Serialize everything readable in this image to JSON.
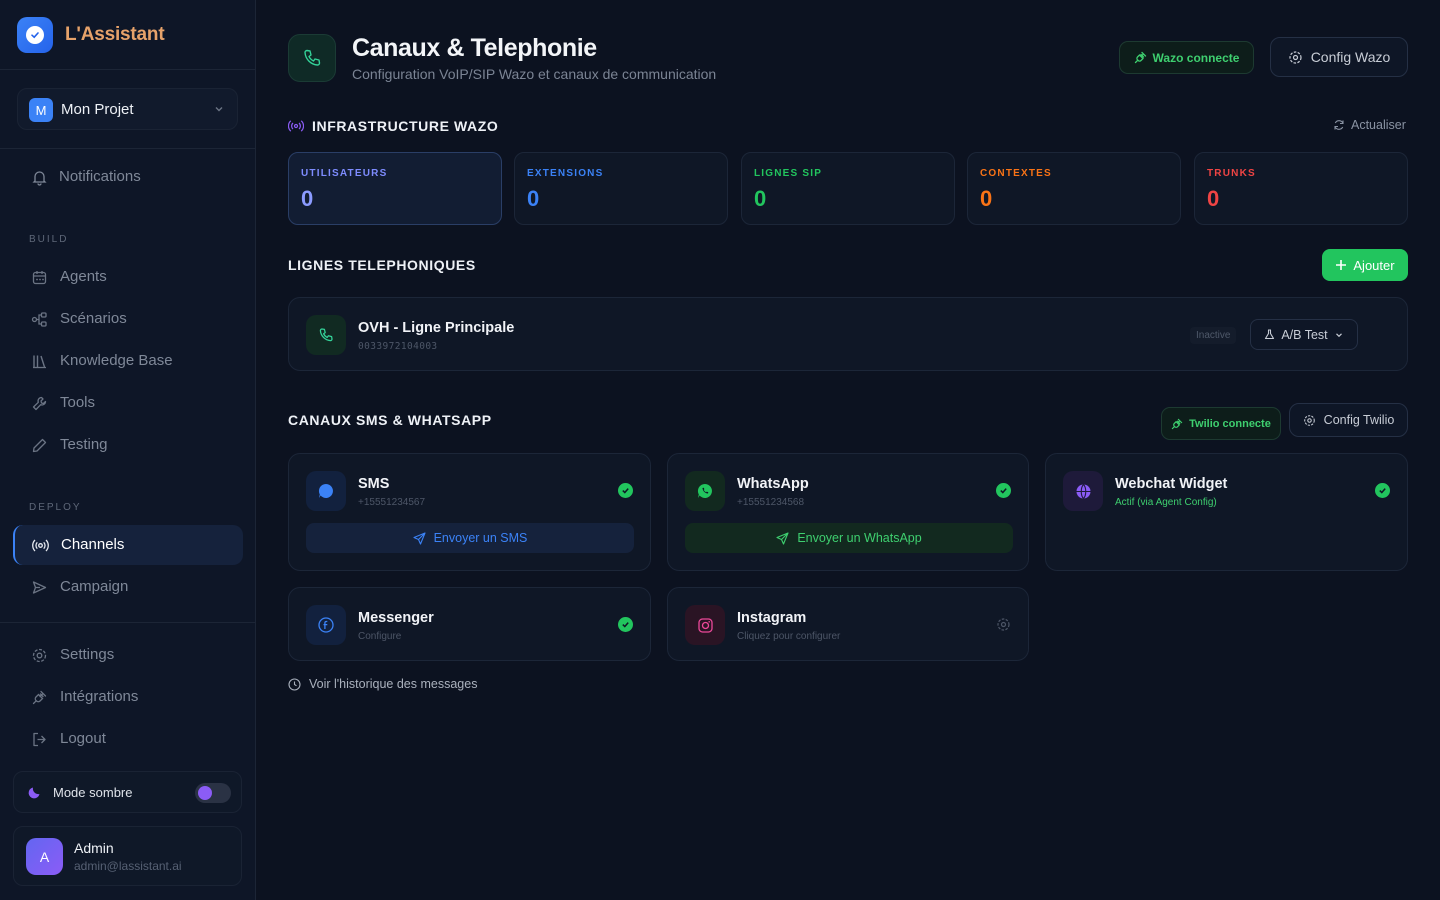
{
  "brand": {
    "name": "L'Assistant"
  },
  "project": {
    "initial": "M",
    "name": "Mon Projet"
  },
  "sidebar": {
    "notifications": "Notifications",
    "build_title": "BUILD",
    "build_items": [
      "Agents",
      "Scénarios",
      "Knowledge Base",
      "Tools",
      "Testing"
    ],
    "deploy_title": "DEPLOY",
    "deploy_items": [
      "Channels",
      "Campaign"
    ],
    "bottom_items": [
      "Settings",
      "Intégrations",
      "Logout"
    ],
    "theme_label": "Mode sombre",
    "user": {
      "initial": "A",
      "name": "Admin",
      "email": "admin@lassistant.ai"
    }
  },
  "header": {
    "title": "Canaux & Telephonie",
    "subtitle": "Configuration VoIP/SIP Wazo et canaux de communication",
    "wazo_status": "Wazo connecte",
    "config_wazo": "Config Wazo"
  },
  "infra": {
    "title": "INFRASTRUCTURE WAZO",
    "refresh": "Actualiser",
    "stats": [
      {
        "label": "UTILISATEURS",
        "value": "0",
        "color": "#8b9bff"
      },
      {
        "label": "EXTENSIONS",
        "value": "0",
        "color": "#3b82f6"
      },
      {
        "label": "LIGNES SIP",
        "value": "0",
        "color": "#22c55e"
      },
      {
        "label": "CONTEXTES",
        "value": "0",
        "color": "#f97316"
      },
      {
        "label": "TRUNKS",
        "value": "0",
        "color": "#ef4444"
      }
    ]
  },
  "lines": {
    "title": "LIGNES TELEPHONIQUES",
    "add": "Ajouter",
    "items": [
      {
        "name": "OVH - Ligne Principale",
        "number": "0033972104003",
        "status": "Inactive",
        "ab": "A/B Test"
      }
    ]
  },
  "channels": {
    "title": "CANAUX SMS & WHATSAPP",
    "twilio_status": "Twilio connecte",
    "config_twilio": "Config Twilio",
    "sms": {
      "name": "SMS",
      "sub": "+15551234567",
      "action": "Envoyer un SMS"
    },
    "whatsapp": {
      "name": "WhatsApp",
      "sub": "+15551234568",
      "action": "Envoyer un WhatsApp"
    },
    "webchat": {
      "name": "Webchat Widget",
      "sub": "Actif (via Agent Config)"
    },
    "messenger": {
      "name": "Messenger",
      "sub": "Configure"
    },
    "instagram": {
      "name": "Instagram",
      "sub": "Cliquez pour configurer"
    },
    "history": "Voir l'historique des messages"
  },
  "colors": {
    "accent": "#3b82f6",
    "success": "#22c55e",
    "brand_text": "#e6a26a"
  }
}
